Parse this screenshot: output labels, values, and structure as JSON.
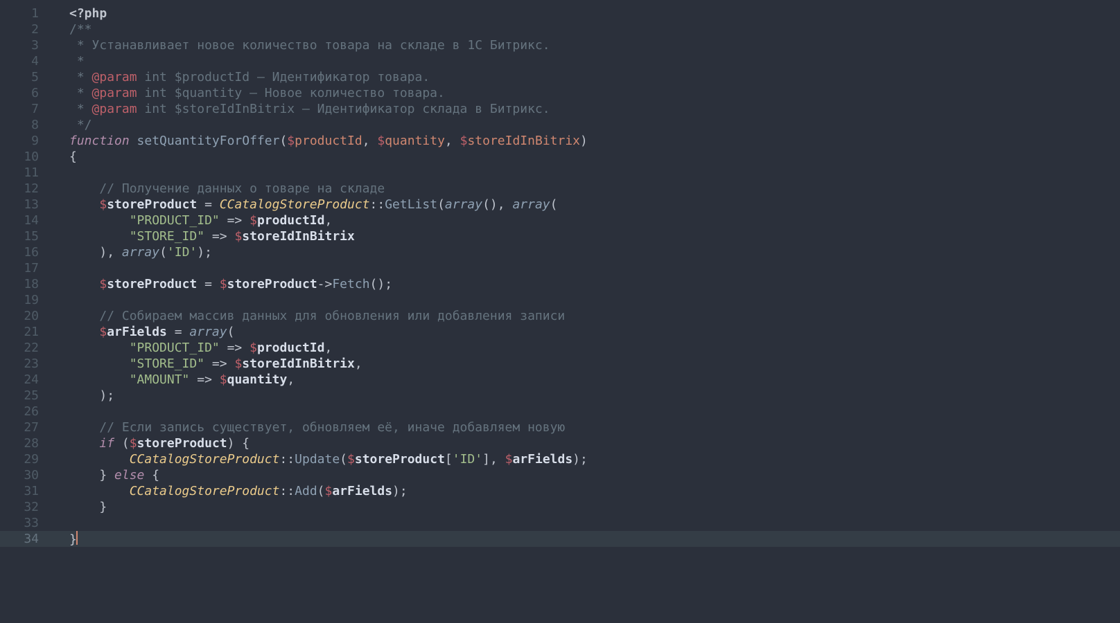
{
  "gutter": {
    "start": 1,
    "end": 34,
    "active": 34
  },
  "code": [
    [
      {
        "text": "<?php",
        "cls": "tk-default bold"
      }
    ],
    [
      {
        "text": "/**",
        "cls": "tk-comment"
      }
    ],
    [
      {
        "text": " * Устанавливает новое количество товара на складе в 1С Битрикс.",
        "cls": "tk-comment"
      }
    ],
    [
      {
        "text": " *",
        "cls": "tk-comment"
      }
    ],
    [
      {
        "text": " * ",
        "cls": "tk-comment"
      },
      {
        "text": "@param",
        "cls": "tk-tag"
      },
      {
        "text": " int $productId – Идентификатор товара.",
        "cls": "tk-comment"
      }
    ],
    [
      {
        "text": " * ",
        "cls": "tk-comment"
      },
      {
        "text": "@param",
        "cls": "tk-tag"
      },
      {
        "text": " int $quantity – Новое количество товара.",
        "cls": "tk-comment"
      }
    ],
    [
      {
        "text": " * ",
        "cls": "tk-comment"
      },
      {
        "text": "@param",
        "cls": "tk-tag"
      },
      {
        "text": " int $storeIdInBitrix – Идентификатор склада в Битрикс.",
        "cls": "tk-comment"
      }
    ],
    [
      {
        "text": " */",
        "cls": "tk-comment"
      }
    ],
    [
      {
        "text": "function",
        "cls": "tk-keyword"
      },
      {
        "text": " ",
        "cls": "tk-plain"
      },
      {
        "text": "setQuantityForOffer",
        "cls": "tk-funcname"
      },
      {
        "text": "(",
        "cls": "tk-punc"
      },
      {
        "text": "$",
        "cls": "tk-sigil"
      },
      {
        "text": "productId",
        "cls": "tk-param"
      },
      {
        "text": ", ",
        "cls": "tk-punc"
      },
      {
        "text": "$",
        "cls": "tk-sigil"
      },
      {
        "text": "quantity",
        "cls": "tk-param"
      },
      {
        "text": ", ",
        "cls": "tk-punc"
      },
      {
        "text": "$",
        "cls": "tk-sigil"
      },
      {
        "text": "storeIdInBitrix",
        "cls": "tk-param"
      },
      {
        "text": ")",
        "cls": "tk-punc"
      }
    ],
    [
      {
        "text": "{",
        "cls": "tk-punc"
      }
    ],
    [],
    [
      {
        "text": "    ",
        "cls": "tk-plain"
      },
      {
        "text": "// Получение данных о товаре на складе",
        "cls": "tk-comment"
      }
    ],
    [
      {
        "text": "    ",
        "cls": "tk-plain"
      },
      {
        "text": "$",
        "cls": "tk-sigil"
      },
      {
        "text": "storeProduct",
        "cls": "tk-var"
      },
      {
        "text": " = ",
        "cls": "tk-punc"
      },
      {
        "text": "CCatalogStoreProduct",
        "cls": "tk-class"
      },
      {
        "text": "::",
        "cls": "tk-punc"
      },
      {
        "text": "GetList",
        "cls": "tk-funccall"
      },
      {
        "text": "(",
        "cls": "tk-punc"
      },
      {
        "text": "array",
        "cls": "tk-builtin italic"
      },
      {
        "text": "(), ",
        "cls": "tk-punc"
      },
      {
        "text": "array",
        "cls": "tk-builtin italic"
      },
      {
        "text": "(",
        "cls": "tk-punc"
      }
    ],
    [
      {
        "text": "        ",
        "cls": "tk-plain"
      },
      {
        "text": "\"PRODUCT_ID\"",
        "cls": "tk-string"
      },
      {
        "text": " => ",
        "cls": "tk-punc"
      },
      {
        "text": "$",
        "cls": "tk-sigil"
      },
      {
        "text": "productId",
        "cls": "tk-var"
      },
      {
        "text": ",",
        "cls": "tk-punc"
      }
    ],
    [
      {
        "text": "        ",
        "cls": "tk-plain"
      },
      {
        "text": "\"STORE_ID\"",
        "cls": "tk-string"
      },
      {
        "text": " => ",
        "cls": "tk-punc"
      },
      {
        "text": "$",
        "cls": "tk-sigil"
      },
      {
        "text": "storeIdInBitrix",
        "cls": "tk-var"
      }
    ],
    [
      {
        "text": "    ",
        "cls": "tk-plain"
      },
      {
        "text": "), ",
        "cls": "tk-punc"
      },
      {
        "text": "array",
        "cls": "tk-builtin italic"
      },
      {
        "text": "(",
        "cls": "tk-punc"
      },
      {
        "text": "'ID'",
        "cls": "tk-string"
      },
      {
        "text": ");",
        "cls": "tk-punc"
      }
    ],
    [],
    [
      {
        "text": "    ",
        "cls": "tk-plain"
      },
      {
        "text": "$",
        "cls": "tk-sigil"
      },
      {
        "text": "storeProduct",
        "cls": "tk-var"
      },
      {
        "text": " = ",
        "cls": "tk-punc"
      },
      {
        "text": "$",
        "cls": "tk-sigil"
      },
      {
        "text": "storeProduct",
        "cls": "tk-var"
      },
      {
        "text": "->",
        "cls": "tk-punc"
      },
      {
        "text": "Fetch",
        "cls": "tk-funccall"
      },
      {
        "text": "();",
        "cls": "tk-punc"
      }
    ],
    [],
    [
      {
        "text": "    ",
        "cls": "tk-plain"
      },
      {
        "text": "// Собираем массив данных для обновления или добавления записи",
        "cls": "tk-comment"
      }
    ],
    [
      {
        "text": "    ",
        "cls": "tk-plain"
      },
      {
        "text": "$",
        "cls": "tk-sigil"
      },
      {
        "text": "arFields",
        "cls": "tk-var"
      },
      {
        "text": " = ",
        "cls": "tk-punc"
      },
      {
        "text": "array",
        "cls": "tk-builtin italic"
      },
      {
        "text": "(",
        "cls": "tk-punc"
      }
    ],
    [
      {
        "text": "        ",
        "cls": "tk-plain"
      },
      {
        "text": "\"PRODUCT_ID\"",
        "cls": "tk-string"
      },
      {
        "text": " => ",
        "cls": "tk-punc"
      },
      {
        "text": "$",
        "cls": "tk-sigil"
      },
      {
        "text": "productId",
        "cls": "tk-var"
      },
      {
        "text": ",",
        "cls": "tk-punc"
      }
    ],
    [
      {
        "text": "        ",
        "cls": "tk-plain"
      },
      {
        "text": "\"STORE_ID\"",
        "cls": "tk-string"
      },
      {
        "text": " => ",
        "cls": "tk-punc"
      },
      {
        "text": "$",
        "cls": "tk-sigil"
      },
      {
        "text": "storeIdInBitrix",
        "cls": "tk-var"
      },
      {
        "text": ",",
        "cls": "tk-punc"
      }
    ],
    [
      {
        "text": "        ",
        "cls": "tk-plain"
      },
      {
        "text": "\"AMOUNT\"",
        "cls": "tk-string"
      },
      {
        "text": " => ",
        "cls": "tk-punc"
      },
      {
        "text": "$",
        "cls": "tk-sigil"
      },
      {
        "text": "quantity",
        "cls": "tk-var"
      },
      {
        "text": ",",
        "cls": "tk-punc"
      }
    ],
    [
      {
        "text": "    ",
        "cls": "tk-plain"
      },
      {
        "text": ");",
        "cls": "tk-punc"
      }
    ],
    [],
    [
      {
        "text": "    ",
        "cls": "tk-plain"
      },
      {
        "text": "// Если запись существует, обновляем её, иначе добавляем новую",
        "cls": "tk-comment"
      }
    ],
    [
      {
        "text": "    ",
        "cls": "tk-plain"
      },
      {
        "text": "if",
        "cls": "tk-keyword"
      },
      {
        "text": " (",
        "cls": "tk-punc"
      },
      {
        "text": "$",
        "cls": "tk-sigil"
      },
      {
        "text": "storeProduct",
        "cls": "tk-var"
      },
      {
        "text": ") {",
        "cls": "tk-punc"
      }
    ],
    [
      {
        "text": "        ",
        "cls": "tk-plain"
      },
      {
        "text": "CCatalogStoreProduct",
        "cls": "tk-class"
      },
      {
        "text": "::",
        "cls": "tk-punc"
      },
      {
        "text": "Update",
        "cls": "tk-funccall"
      },
      {
        "text": "(",
        "cls": "tk-punc"
      },
      {
        "text": "$",
        "cls": "tk-sigil"
      },
      {
        "text": "storeProduct",
        "cls": "tk-var"
      },
      {
        "text": "[",
        "cls": "tk-punc"
      },
      {
        "text": "'ID'",
        "cls": "tk-string"
      },
      {
        "text": "], ",
        "cls": "tk-punc"
      },
      {
        "text": "$",
        "cls": "tk-sigil"
      },
      {
        "text": "arFields",
        "cls": "tk-var"
      },
      {
        "text": ");",
        "cls": "tk-punc"
      }
    ],
    [
      {
        "text": "    ",
        "cls": "tk-plain"
      },
      {
        "text": "} ",
        "cls": "tk-punc"
      },
      {
        "text": "else",
        "cls": "tk-keyword"
      },
      {
        "text": " {",
        "cls": "tk-punc"
      }
    ],
    [
      {
        "text": "        ",
        "cls": "tk-plain"
      },
      {
        "text": "CCatalogStoreProduct",
        "cls": "tk-class"
      },
      {
        "text": "::",
        "cls": "tk-punc"
      },
      {
        "text": "Add",
        "cls": "tk-funccall"
      },
      {
        "text": "(",
        "cls": "tk-punc"
      },
      {
        "text": "$",
        "cls": "tk-sigil"
      },
      {
        "text": "arFields",
        "cls": "tk-var"
      },
      {
        "text": ");",
        "cls": "tk-punc"
      }
    ],
    [
      {
        "text": "    ",
        "cls": "tk-plain"
      },
      {
        "text": "}",
        "cls": "tk-punc"
      }
    ],
    [],
    [
      {
        "text": "}",
        "cls": "tk-punc"
      },
      {
        "cursor": true
      }
    ]
  ]
}
